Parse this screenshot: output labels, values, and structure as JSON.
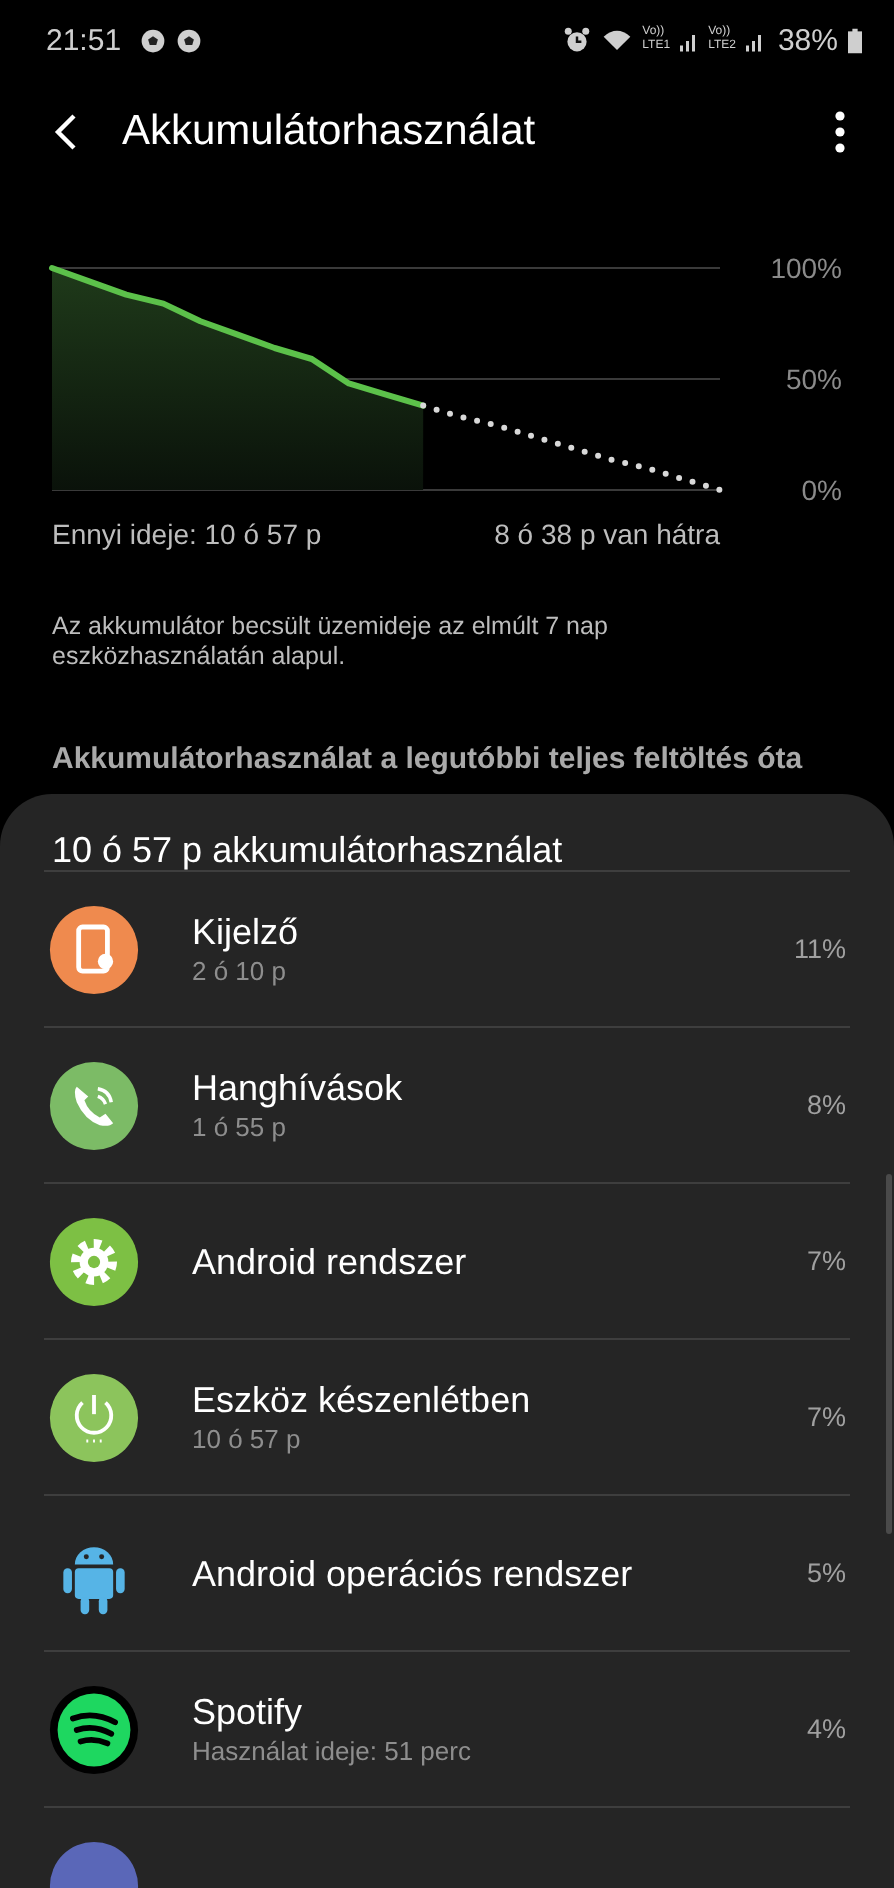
{
  "status_bar": {
    "time": "21:51",
    "sims": [
      {
        "top": "Vo))",
        "bottom": "LTE1"
      },
      {
        "top": "Vo))",
        "bottom": "LTE2"
      }
    ],
    "battery": "38%"
  },
  "app_bar": {
    "title": "Akkumulátorhasználat"
  },
  "chart": {
    "chart_data": {
      "type": "line",
      "yticks": [
        {
          "value": 100,
          "label": "100%"
        },
        {
          "value": 50,
          "label": "50%"
        },
        {
          "value": 0,
          "label": "0%"
        }
      ],
      "ylim": [
        0,
        100
      ],
      "series": [
        {
          "color": "#5cc14a",
          "line_style": "solid",
          "values": [
            100,
            94,
            88,
            84,
            76,
            70,
            64,
            59,
            48,
            43,
            38,
            null,
            null,
            null,
            null,
            null,
            null,
            null,
            null
          ]
        },
        {
          "color": "#d8d8d8",
          "line_style": "dotted",
          "values": [
            null,
            null,
            null,
            null,
            null,
            null,
            null,
            null,
            null,
            null,
            38,
            33,
            29,
            24,
            19,
            14,
            10,
            5,
            0
          ]
        }
      ]
    },
    "elapsed": "Ennyi ideje: 10 ó 57 p",
    "remaining": "8 ó 38 p van hátra"
  },
  "note": "Az akkumulátor becsült üzemideje az elmúlt 7 nap eszközhasználatán alapul.",
  "section_title": "Akkumulátorhasználat a legutóbbi teljes feltöltés óta",
  "usage": {
    "title": "10 ó 57 p akkumulátorhasználat",
    "items": [
      {
        "kind": "display",
        "color": "#ef8a4e",
        "name": "Kijelző",
        "detail": "2 ó 10 p",
        "percent": "11%"
      },
      {
        "kind": "call",
        "color": "#7cbb66",
        "name": "Hanghívások",
        "detail": "1 ó 55 p",
        "percent": "8%"
      },
      {
        "kind": "system",
        "color": "#7dc044",
        "name": "Android rendszer",
        "percent": "7%"
      },
      {
        "kind": "standby",
        "color": "#8cc45c",
        "name": "Eszköz készenlétben",
        "detail": "10 ó 57 p",
        "percent": "7%"
      },
      {
        "kind": "android",
        "color": "#56b4e6",
        "name": "Android operációs rendszer",
        "percent": "5%"
      },
      {
        "kind": "spotify",
        "color": "#1ed760",
        "name": "Spotify",
        "detail": "Használat ideje: 51 perc",
        "percent": "4%"
      },
      {
        "kind": "aod",
        "color": "#5a67b8"
      }
    ]
  }
}
